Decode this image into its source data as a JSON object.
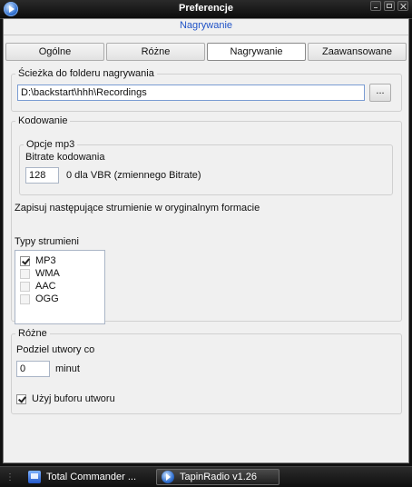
{
  "window": {
    "title": "Preferencje",
    "subtitle": "Nagrywanie"
  },
  "tabs": [
    {
      "label": "Ogólne",
      "active": false
    },
    {
      "label": "Różne",
      "active": false
    },
    {
      "label": "Nagrywanie",
      "active": true
    },
    {
      "label": "Zaawansowane",
      "active": false
    }
  ],
  "recording_path": {
    "legend": "Ścieżka do folderu nagrywania",
    "value": "D:\\backstart\\hhh\\Recordings",
    "browse_label": "..."
  },
  "encoding": {
    "legend": "Kodowanie",
    "mp3": {
      "legend": "Opcje mp3",
      "bitrate_label": "Bitrate kodowania",
      "bitrate_value": "128",
      "bitrate_hint": "0 dla VBR (zmiennego Bitrate)"
    },
    "save_original_label": "Zapisuj następujące strumienie w oryginalnym formacie",
    "stream_types_label": "Typy strumieni",
    "stream_types": [
      {
        "label": "MP3",
        "checked": true
      },
      {
        "label": "WMA",
        "checked": false
      },
      {
        "label": "AAC",
        "checked": false
      },
      {
        "label": "OGG",
        "checked": false
      }
    ]
  },
  "misc": {
    "legend": "Różne",
    "split_label": "Podziel utwory co",
    "split_value": "0",
    "split_unit": "minut",
    "use_buffer_label": "Użyj buforu utworu",
    "use_buffer_checked": true
  },
  "taskbar": {
    "items": [
      {
        "label": "Total Commander ...",
        "icon": "total-commander-icon"
      },
      {
        "label": "TapinRadio v1.26",
        "icon": "tapinradio-icon",
        "active": true
      }
    ]
  }
}
